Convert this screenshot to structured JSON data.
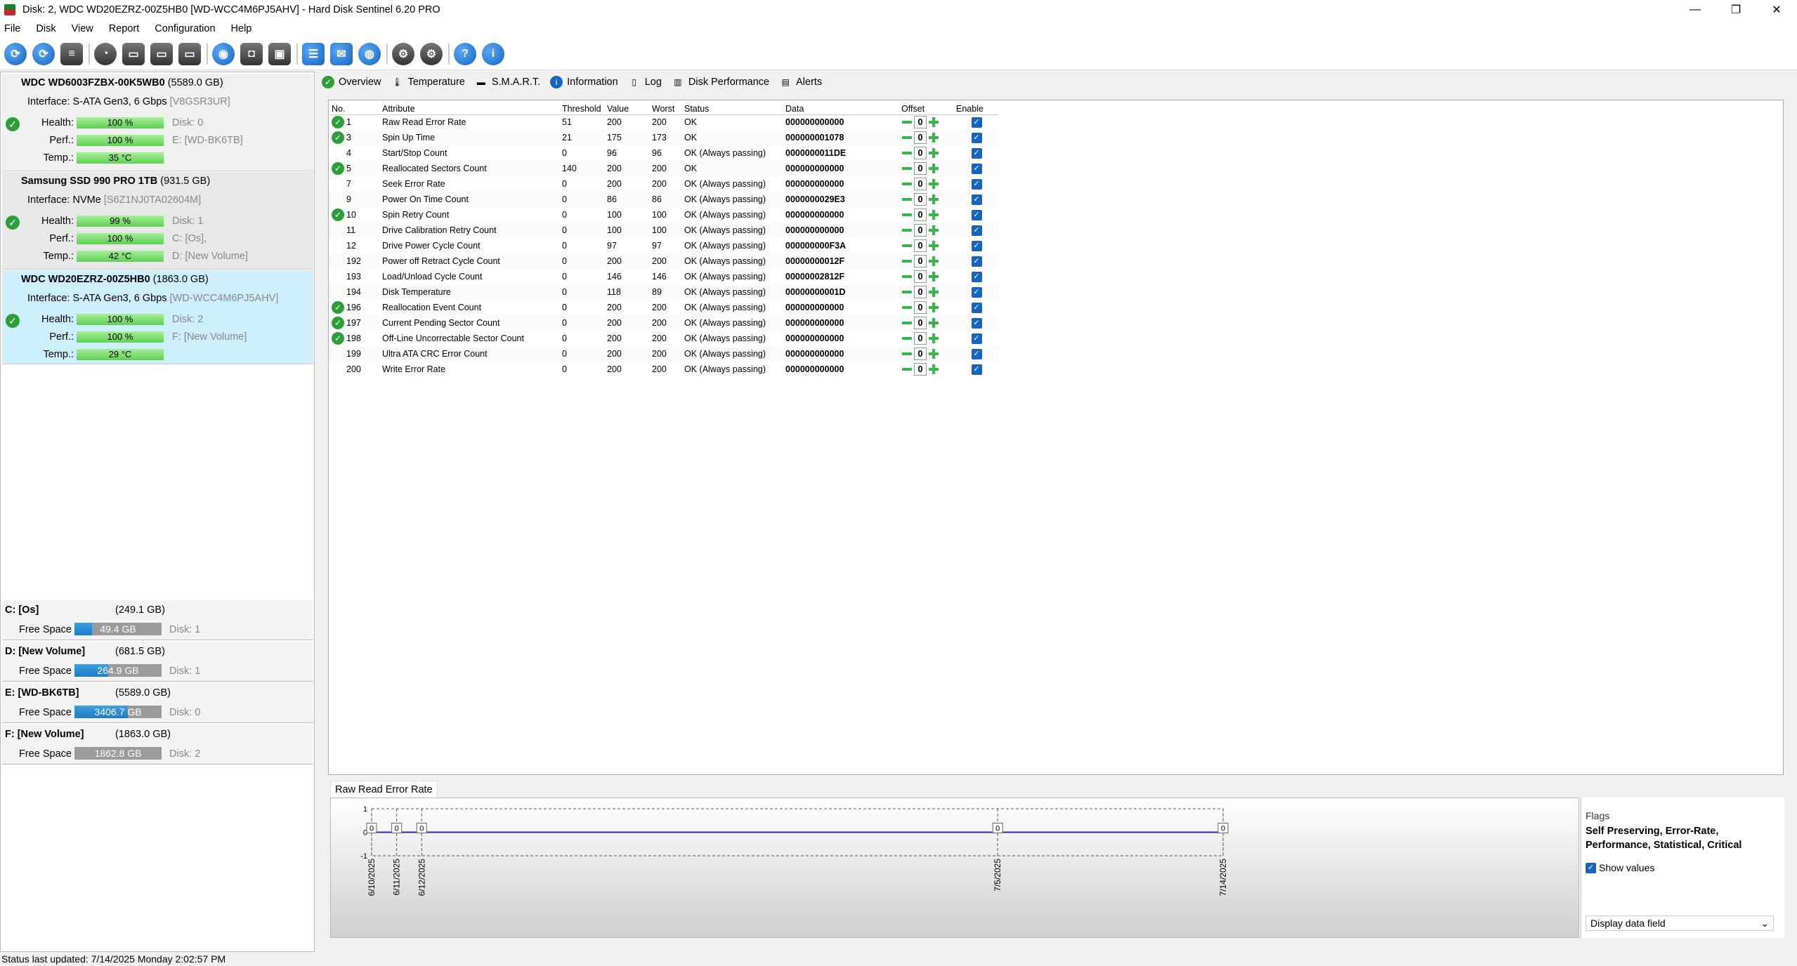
{
  "window": {
    "title": "Disk: 2, WDC WD20EZRZ-00Z5HB0 [WD-WCC4M6PJ5AHV]  -  Hard Disk Sentinel 6.20 PRO",
    "minimize": "—",
    "maximize": "❐",
    "close": "✕"
  },
  "menu": [
    "File",
    "Disk",
    "View",
    "Report",
    "Configuration",
    "Help"
  ],
  "disks": [
    {
      "name": "WDC WD6003FZBX-00K5WB0",
      "capacity": "(5589.0 GB)",
      "iface_label": "Interface:",
      "iface": "S-ATA Gen3, 6 Gbps",
      "serial": "[V8GSR3UR]",
      "health": "100 %",
      "perf": "100 %",
      "temp": "35 °C",
      "ext1": "Disk: 0",
      "ext2": "E: [WD-BK6TB]"
    },
    {
      "name": "Samsung SSD 990 PRO 1TB",
      "capacity": "(931.5 GB)",
      "iface_label": "Interface:",
      "iface": "NVMe",
      "serial": "[S6Z1NJ0TA02604M]",
      "health": "99 %",
      "perf": "100 %",
      "temp": "42 °C",
      "ext1": "Disk: 1",
      "ext2": "C: [Os],",
      "ext3": "D: [New Volume]"
    },
    {
      "name": "WDC WD20EZRZ-00Z5HB0",
      "capacity": "(1863.0 GB)",
      "iface_label": "Interface:",
      "iface": "S-ATA Gen3, 6 Gbps",
      "serial": "[WD-WCC4M6PJ5AHV]",
      "health": "100 %",
      "perf": "100 %",
      "temp": "29 °C",
      "ext1": "Disk: 2",
      "ext2": "F: [New Volume]"
    }
  ],
  "labels": {
    "health": "Health:",
    "perf": "Perf.:",
    "temp": "Temp.:",
    "free": "Free Space"
  },
  "volumes": [
    {
      "name": "C: [Os]",
      "capacity": "(249.1 GB)",
      "free": "49.4 GB",
      "disk": "Disk: 1",
      "fill": 0.2
    },
    {
      "name": "D: [New Volume]",
      "capacity": "(681.5 GB)",
      "free": "264.9 GB",
      "disk": "Disk: 1",
      "fill": 0.39
    },
    {
      "name": "E: [WD-BK6TB]",
      "capacity": "(5589.0 GB)",
      "free": "3406.7 GB",
      "disk": "Disk: 0",
      "fill": 0.61
    },
    {
      "name": "F: [New Volume]",
      "capacity": "(1863.0 GB)",
      "free": "1862.8 GB",
      "disk": "Disk: 2",
      "fill": 1.0
    }
  ],
  "tabs": [
    "Overview",
    "Temperature",
    "S.M.A.R.T.",
    "Information",
    "Log",
    "Disk Performance",
    "Alerts"
  ],
  "smart_headers": [
    "No.",
    "Attribute",
    "Threshold",
    "Value",
    "Worst",
    "Status",
    "Data",
    "Offset",
    "Enable"
  ],
  "smart_rows": [
    {
      "ok": true,
      "no": "1",
      "attr": "Raw Read Error Rate",
      "thr": "51",
      "val": "200",
      "worst": "200",
      "status": "OK",
      "data": "000000000000",
      "offset": "0"
    },
    {
      "ok": true,
      "no": "3",
      "attr": "Spin Up Time",
      "thr": "21",
      "val": "175",
      "worst": "173",
      "status": "OK",
      "data": "000000001078",
      "offset": "0"
    },
    {
      "ok": false,
      "no": "4",
      "attr": "Start/Stop Count",
      "thr": "0",
      "val": "96",
      "worst": "96",
      "status": "OK (Always passing)",
      "data": "0000000011DE",
      "offset": "0"
    },
    {
      "ok": true,
      "no": "5",
      "attr": "Reallocated Sectors Count",
      "thr": "140",
      "val": "200",
      "worst": "200",
      "status": "OK",
      "data": "000000000000",
      "offset": "0"
    },
    {
      "ok": false,
      "no": "7",
      "attr": "Seek Error Rate",
      "thr": "0",
      "val": "200",
      "worst": "200",
      "status": "OK (Always passing)",
      "data": "000000000000",
      "offset": "0"
    },
    {
      "ok": false,
      "no": "9",
      "attr": "Power On Time Count",
      "thr": "0",
      "val": "86",
      "worst": "86",
      "status": "OK (Always passing)",
      "data": "0000000029E3",
      "offset": "0"
    },
    {
      "ok": true,
      "no": "10",
      "attr": "Spin Retry Count",
      "thr": "0",
      "val": "100",
      "worst": "100",
      "status": "OK (Always passing)",
      "data": "000000000000",
      "offset": "0"
    },
    {
      "ok": false,
      "no": "11",
      "attr": "Drive Calibration Retry Count",
      "thr": "0",
      "val": "100",
      "worst": "100",
      "status": "OK (Always passing)",
      "data": "000000000000",
      "offset": "0"
    },
    {
      "ok": false,
      "no": "12",
      "attr": "Drive Power Cycle Count",
      "thr": "0",
      "val": "97",
      "worst": "97",
      "status": "OK (Always passing)",
      "data": "000000000F3A",
      "offset": "0"
    },
    {
      "ok": false,
      "no": "192",
      "attr": "Power off Retract Cycle Count",
      "thr": "0",
      "val": "200",
      "worst": "200",
      "status": "OK (Always passing)",
      "data": "00000000012F",
      "offset": "0"
    },
    {
      "ok": false,
      "no": "193",
      "attr": "Load/Unload Cycle Count",
      "thr": "0",
      "val": "146",
      "worst": "146",
      "status": "OK (Always passing)",
      "data": "00000002812F",
      "offset": "0"
    },
    {
      "ok": false,
      "no": "194",
      "attr": "Disk Temperature",
      "thr": "0",
      "val": "118",
      "worst": "89",
      "status": "OK (Always passing)",
      "data": "00000000001D",
      "offset": "0"
    },
    {
      "ok": true,
      "no": "196",
      "attr": "Reallocation Event Count",
      "thr": "0",
      "val": "200",
      "worst": "200",
      "status": "OK (Always passing)",
      "data": "000000000000",
      "offset": "0"
    },
    {
      "ok": true,
      "no": "197",
      "attr": "Current Pending Sector Count",
      "thr": "0",
      "val": "200",
      "worst": "200",
      "status": "OK (Always passing)",
      "data": "000000000000",
      "offset": "0"
    },
    {
      "ok": true,
      "no": "198",
      "attr": "Off-Line Uncorrectable Sector Count",
      "thr": "0",
      "val": "200",
      "worst": "200",
      "status": "OK (Always passing)",
      "data": "000000000000",
      "offset": "0"
    },
    {
      "ok": false,
      "no": "199",
      "attr": "Ultra ATA CRC Error Count",
      "thr": "0",
      "val": "200",
      "worst": "200",
      "status": "OK (Always passing)",
      "data": "000000000000",
      "offset": "0"
    },
    {
      "ok": false,
      "no": "200",
      "attr": "Write Error Rate",
      "thr": "0",
      "val": "200",
      "worst": "200",
      "status": "OK (Always passing)",
      "data": "000000000000",
      "offset": "0"
    }
  ],
  "graph": {
    "title": "Raw Read Error Rate",
    "y_ticks": [
      "1",
      "0",
      "-1"
    ],
    "dates": [
      "6/10/2025",
      "6/11/2025",
      "6/12/2025",
      "7/5/2025",
      "7/14/2025"
    ],
    "values": [
      0,
      0,
      0,
      0,
      0
    ],
    "day_offsets": [
      0,
      1,
      2,
      25,
      34
    ],
    "line_color": "#2b2b9e"
  },
  "flags": {
    "title": "Flags",
    "value": "Self Preserving, Error-Rate, Performance, Statistical, Critical",
    "show_values": "Show values",
    "display_field": "Display data field"
  },
  "status": "Status last updated: 7/14/2025 Monday 2:02:57 PM"
}
